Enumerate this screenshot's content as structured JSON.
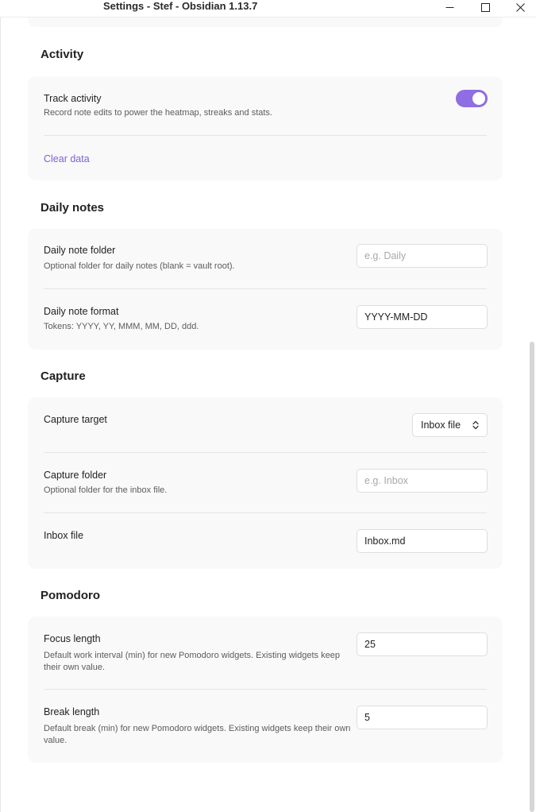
{
  "window": {
    "title": "Settings - Stef - Obsidian 1.13.7"
  },
  "sections": {
    "activity": {
      "heading": "Activity",
      "track_activity": {
        "name": "Track activity",
        "desc": "Record note edits to power the heatmap, streaks and stats.",
        "enabled": true
      },
      "clear_data_label": "Clear data"
    },
    "daily_notes": {
      "heading": "Daily notes",
      "folder": {
        "name": "Daily note folder",
        "desc": "Optional folder for daily notes (blank = vault root).",
        "value": "",
        "placeholder": "e.g. Daily"
      },
      "format": {
        "name": "Daily note format",
        "desc": "Tokens: YYYY, YY, MMM, MM, DD, ddd.",
        "value": "YYYY-MM-DD"
      }
    },
    "capture": {
      "heading": "Capture",
      "target": {
        "name": "Capture target",
        "selected": "Inbox file"
      },
      "folder": {
        "name": "Capture folder",
        "desc": "Optional folder for the inbox file.",
        "value": "",
        "placeholder": "e.g. Inbox"
      },
      "inbox_file": {
        "name": "Inbox file",
        "value": "Inbox.md"
      }
    },
    "pomodoro": {
      "heading": "Pomodoro",
      "focus": {
        "name": "Focus length",
        "desc": "Default work interval (min) for new Pomodoro widgets. Existing widgets keep their own value.",
        "value": "25"
      },
      "break": {
        "name": "Break length",
        "desc": "Default break (min) for new Pomodoro widgets. Existing widgets keep their own value.",
        "value": "5"
      }
    }
  },
  "colors": {
    "accent": "#8f6de3",
    "link": "#7f5ed9",
    "card_bg": "#f9f9f9"
  },
  "icons": {
    "minimize": "minimize-icon",
    "maximize": "maximize-icon",
    "close": "close-icon",
    "dropdown": "chevron-up-down-icon"
  }
}
